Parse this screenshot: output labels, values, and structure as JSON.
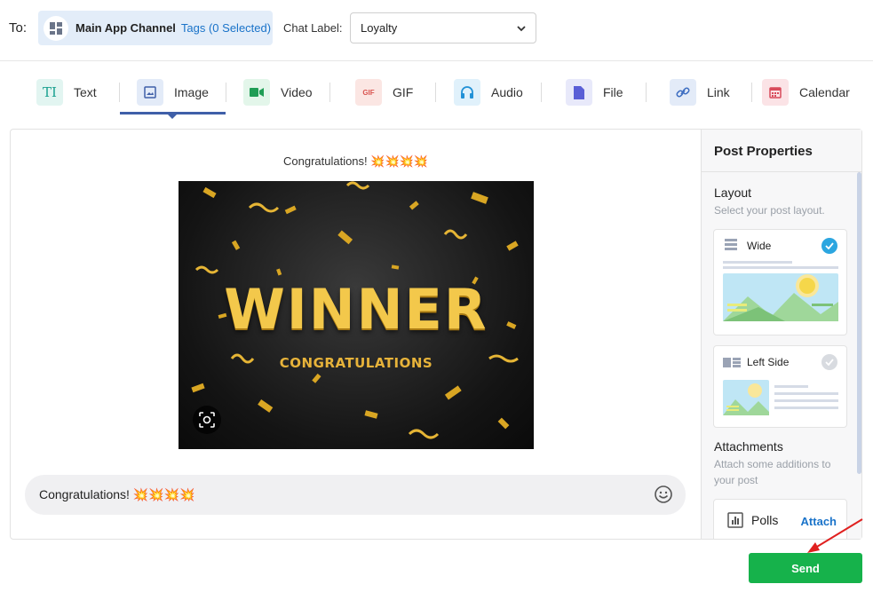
{
  "header": {
    "to_label": "To:",
    "channel_name": "Main App Channel",
    "tags_label": "Tags (0 Selected)",
    "chat_label": "Chat Label:",
    "chat_label_value": "Loyalty"
  },
  "tabs": [
    {
      "label": "Text",
      "icon": "text-icon",
      "glyph": "TI",
      "active": false
    },
    {
      "label": "Image",
      "icon": "image-icon",
      "active": true
    },
    {
      "label": "Video",
      "icon": "video-icon",
      "active": false
    },
    {
      "label": "GIF",
      "icon": "gif-icon",
      "glyph": "GIF",
      "active": false
    },
    {
      "label": "Audio",
      "icon": "headphones-icon",
      "active": false
    },
    {
      "label": "File",
      "icon": "file-icon",
      "active": false
    },
    {
      "label": "Link",
      "icon": "link-icon",
      "active": false
    },
    {
      "label": "Calendar",
      "icon": "calendar-icon",
      "active": false
    }
  ],
  "editor": {
    "caption": "Congratulations! 💥💥💥💥",
    "image": {
      "headline": "WINNER",
      "subline": "CONGRATULATIONS"
    },
    "message_text": "Congratulations! 💥💥💥💥"
  },
  "properties": {
    "title": "Post Properties",
    "layout_title": "Layout",
    "layout_subtitle": "Select your post layout.",
    "layouts": [
      {
        "label": "Wide",
        "selected": true
      },
      {
        "label": "Left Side",
        "selected": false
      }
    ],
    "attachments_title": "Attachments",
    "attachments_subtitle": "Attach some additions to your post",
    "poll_label": "Polls",
    "attach_label": "Attach"
  },
  "actions": {
    "send_label": "Send"
  },
  "colors": {
    "accent": "#3f5fa8",
    "link": "#1a73c9",
    "send": "#16b24b",
    "check": "#2ca6e0"
  }
}
